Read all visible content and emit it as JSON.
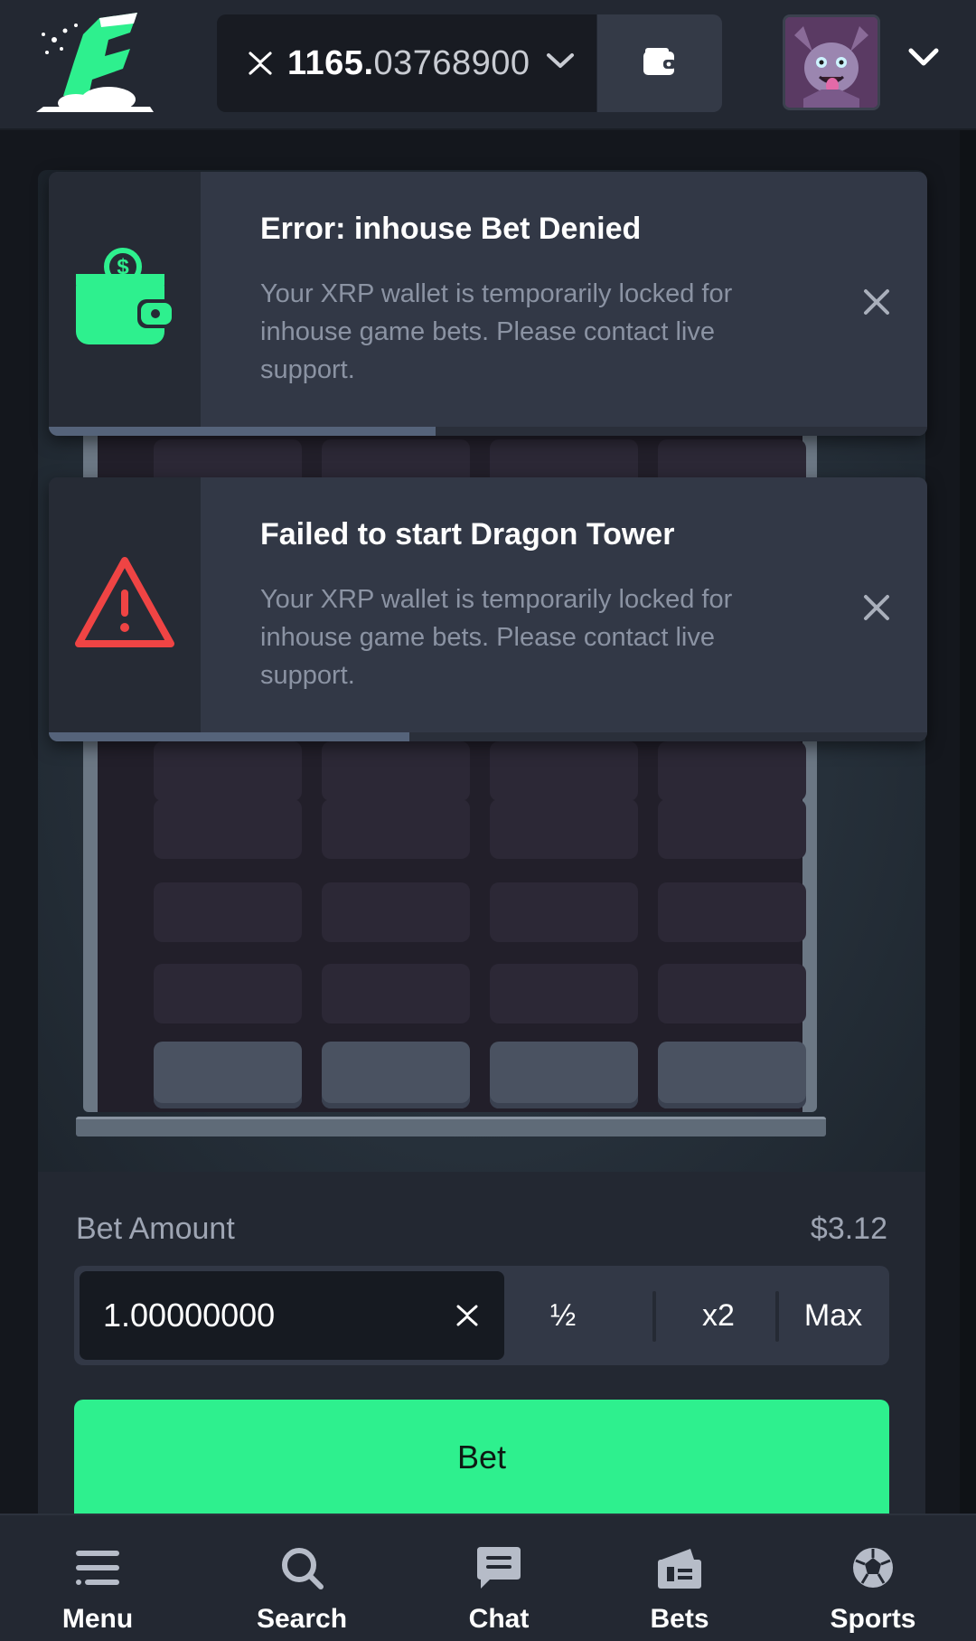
{
  "header": {
    "balance_int": "1165.",
    "balance_dec": "03768900",
    "currency_icon": "xrp-icon",
    "wallet_icon": "wallet-icon",
    "avatar_icon": "dragon-avatar"
  },
  "toasts": [
    {
      "title": "Error: inhouse Bet Denied",
      "message": "Your XRP wallet is temporarily locked for inhouse game bets. Please contact live support.",
      "icon": "wallet-dollar-icon",
      "progress": 0.44
    },
    {
      "title": "Failed to start Dragon Tower",
      "message": "Your XRP wallet is temporarily locked for inhouse game bets. Please contact live support.",
      "icon": "warning-icon",
      "progress": 0.41
    }
  ],
  "bet": {
    "label": "Bet Amount",
    "usd_value": "$3.12",
    "amount": "1.00000000",
    "half_label": "½",
    "double_label": "x2",
    "max_label": "Max",
    "submit_label": "Bet"
  },
  "nav": {
    "items": [
      {
        "label": "Menu",
        "icon": "menu-icon"
      },
      {
        "label": "Search",
        "icon": "search-icon"
      },
      {
        "label": "Chat",
        "icon": "chat-icon"
      },
      {
        "label": "Bets",
        "icon": "bets-icon"
      },
      {
        "label": "Sports",
        "icon": "soccer-ball-icon"
      }
    ]
  },
  "colors": {
    "accent": "#2ef08e",
    "error": "#ef4444",
    "panel": "#323846",
    "background": "#14171d"
  }
}
